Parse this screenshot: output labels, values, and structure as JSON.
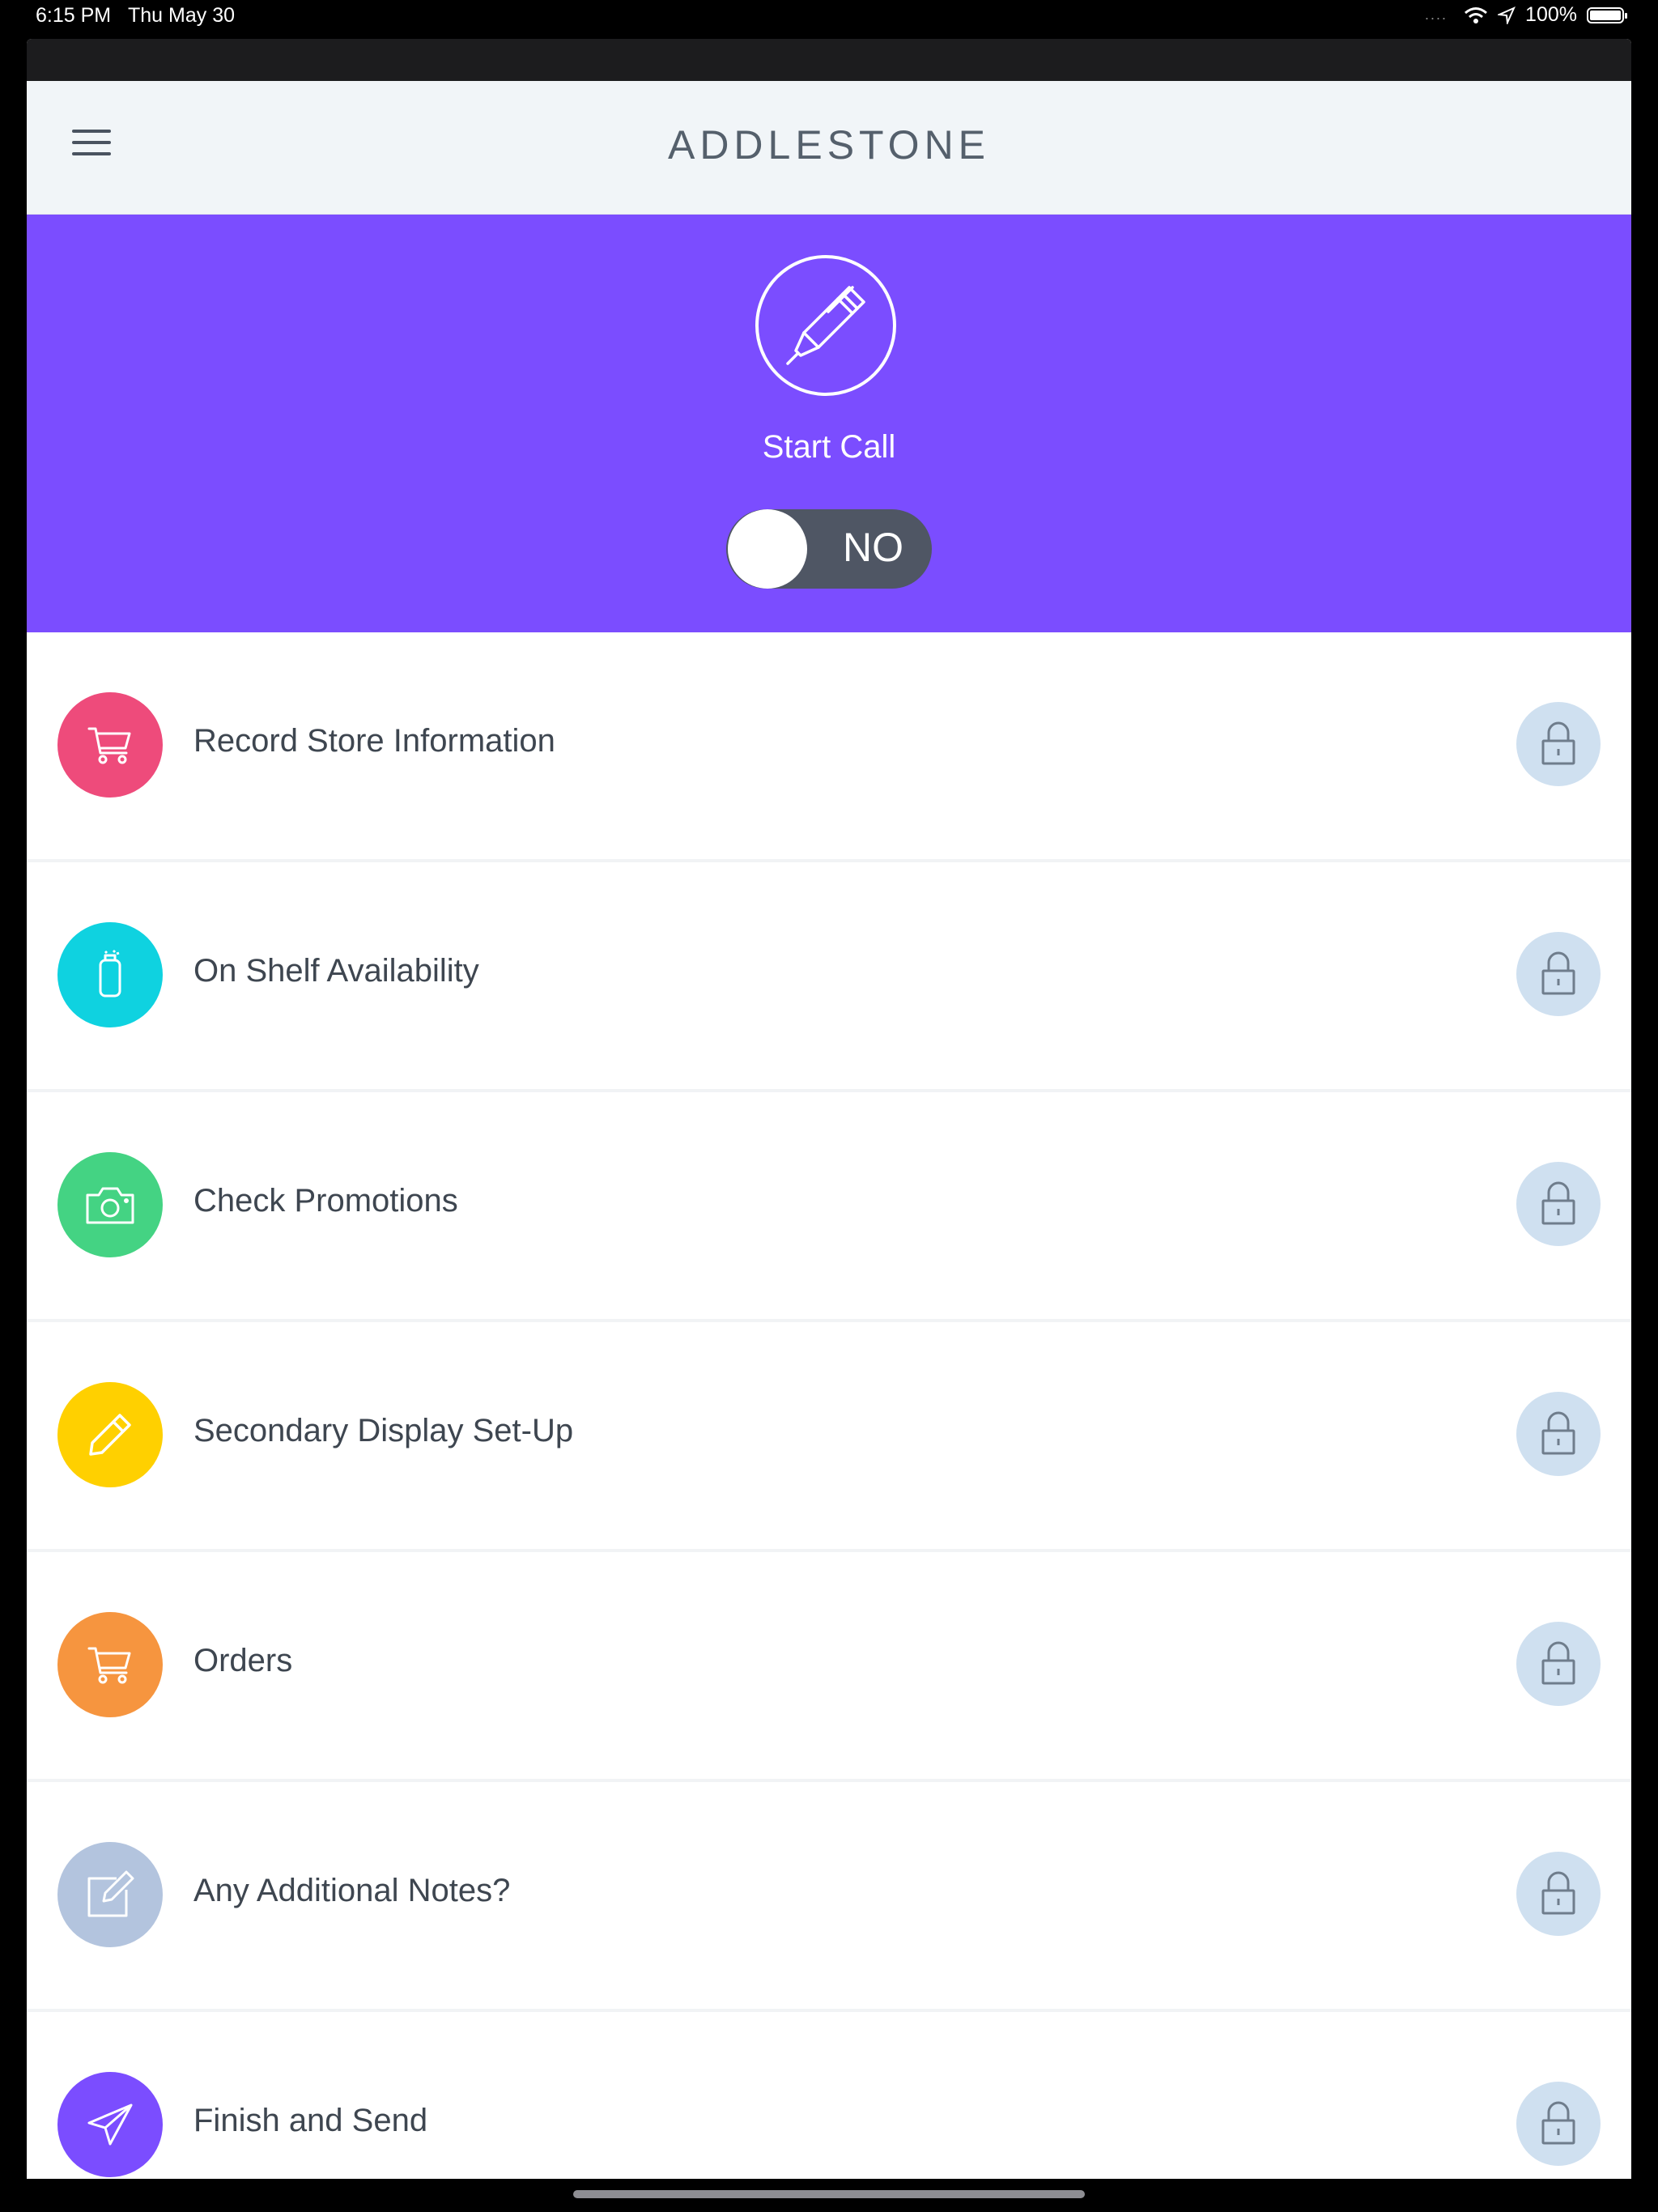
{
  "status_bar": {
    "time": "6:15 PM",
    "date": "Thu May 30",
    "battery": "100%",
    "dots": "....",
    "battery_level_percent": 100
  },
  "navbar": {
    "title": "ADDLESTONE",
    "menu_icon": "hamburger-menu-icon"
  },
  "call": {
    "label": "Start Call",
    "toggle_text": "NO",
    "toggle_on": false,
    "icon": "pen-icon"
  },
  "colors": {
    "hero": "#7b4dff",
    "lock_bg": "#cfe0f0"
  },
  "tasks": [
    {
      "label": "Record Store Information",
      "icon": "cart-icon",
      "color": "#ee4b7b",
      "locked": true
    },
    {
      "label": "On Shelf Availability",
      "icon": "bottle-icon",
      "color": "#0fd2e0",
      "locked": true
    },
    {
      "label": "Check Promotions",
      "icon": "camera-icon",
      "color": "#44d383",
      "locked": true
    },
    {
      "label": "Secondary Display Set-Up",
      "icon": "pencil-icon",
      "color": "#ffd000",
      "locked": true
    },
    {
      "label": "Orders",
      "icon": "cart-icon",
      "color": "#f6953f",
      "locked": true
    },
    {
      "label": "Any Additional Notes?",
      "icon": "note-edit-icon",
      "color": "#b3c4de",
      "locked": true
    },
    {
      "label": "Finish and Send",
      "icon": "paper-plane-icon",
      "color": "#7b4dff",
      "locked": true
    }
  ]
}
